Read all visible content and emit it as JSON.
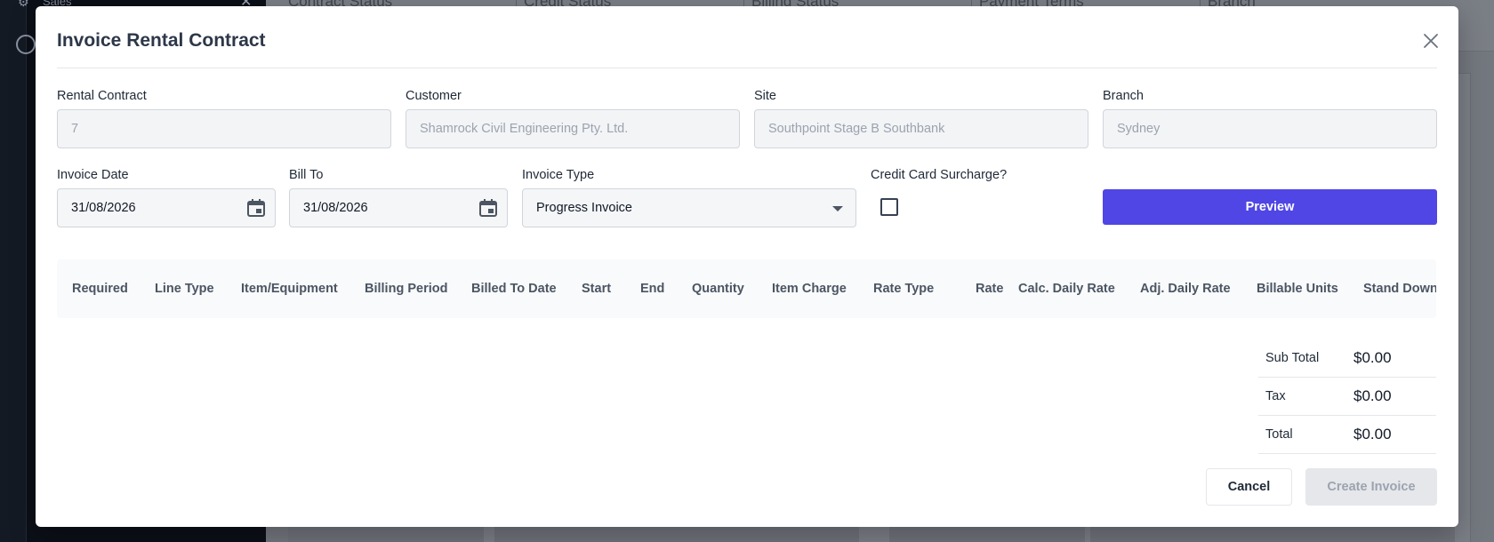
{
  "background": {
    "sidebar_title": "Sales",
    "columns": [
      "Contract Status",
      "Credit Status",
      "Billing Status",
      "Payment Terms",
      "Branch"
    ]
  },
  "modal": {
    "title": "Invoice Rental Contract",
    "fields": {
      "rental_contract": {
        "label": "Rental Contract",
        "value": "7"
      },
      "customer": {
        "label": "Customer",
        "value": "Shamrock Civil Engineering Pty. Ltd."
      },
      "site": {
        "label": "Site",
        "value": "Southpoint Stage B Southbank"
      },
      "branch": {
        "label": "Branch",
        "value": "Sydney"
      },
      "invoice_date": {
        "label": "Invoice Date",
        "value": "31/08/2026"
      },
      "bill_to": {
        "label": "Bill To",
        "value": "31/08/2026"
      },
      "invoice_type": {
        "label": "Invoice Type",
        "value": "Progress Invoice"
      },
      "credit_card_surcharge": {
        "label": "Credit Card Surcharge?",
        "checked": false
      }
    },
    "preview_label": "Preview",
    "table_columns": [
      "Required",
      "Line Type",
      "Item/Equipment",
      "Billing Period",
      "Billed To Date",
      "Start",
      "End",
      "Quantity",
      "Item Charge",
      "Rate Type",
      "Rate",
      "Calc. Daily Rate",
      "Adj. Daily Rate",
      "Billable Units",
      "Stand Down"
    ],
    "totals": [
      {
        "label": "Sub Total",
        "value": "$0.00"
      },
      {
        "label": "Tax",
        "value": "$0.00"
      },
      {
        "label": "Total",
        "value": "$0.00"
      }
    ],
    "cancel_label": "Cancel",
    "create_label": "Create Invoice"
  },
  "colors": {
    "accent": "#4f46e5"
  },
  "icons": [
    "close-icon",
    "calendar-icon",
    "chevron-down-icon"
  ]
}
